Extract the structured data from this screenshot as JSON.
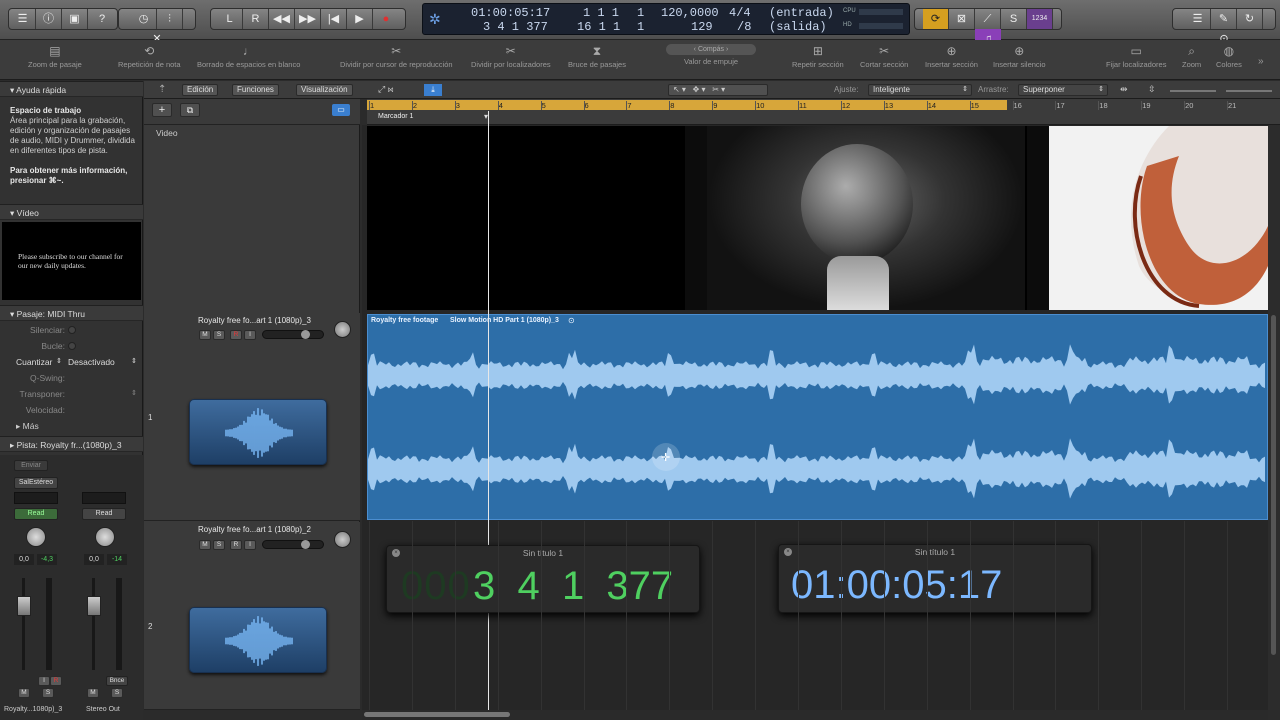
{
  "transport": {
    "position_time": "01:00:05:17",
    "position_bars": "3 4 1 377",
    "end_time_a": "1 1 1",
    "end_time_b": "1",
    "end_bars_a": "16 1 1",
    "end_bars_b": "1",
    "tempo": "120,0000",
    "tempo_sub": "129",
    "signature": "4/4",
    "signature_sub": "/8",
    "input_label": "(entrada)",
    "output_label": "(salida)",
    "cpu_label": "CPU",
    "hd_label": "HD",
    "count_in": "1234"
  },
  "toolbar": {
    "items": [
      {
        "label": "Zoom de pasaje",
        "icon": "piano-roll-icon"
      },
      {
        "label": "Repetición de nota",
        "icon": "repeat-icon"
      },
      {
        "label": "Borrado de espacios en blanco",
        "icon": "note-icon"
      },
      {
        "label": "Dividir por cursor de reproducción",
        "icon": "scissors-icon"
      },
      {
        "label": "Dividir por localizadores",
        "icon": "scissors-icon"
      },
      {
        "label": "Bruce de pasajes",
        "icon": "crossfade-icon"
      },
      {
        "label": "Valor de empuje",
        "icon": "nudge-icon"
      },
      {
        "label": "Repetir sección",
        "icon": "repeat-section-icon"
      },
      {
        "label": "Cortar sección",
        "icon": "cut-section-icon"
      },
      {
        "label": "Insertar sección",
        "icon": "insert-section-icon"
      },
      {
        "label": "Insertar silencio",
        "icon": "insert-silence-icon"
      },
      {
        "label": "Fijar localizadores",
        "icon": "locators-icon"
      },
      {
        "label": "Zoom",
        "icon": "zoom-icon"
      },
      {
        "label": "Colores",
        "icon": "palette-icon"
      }
    ],
    "compas_label": "Compás"
  },
  "quickhelp": {
    "header": "Ayuda rápida",
    "title": "Espacio de trabajo",
    "body": "Área principal para la grabación, edición y organización de pasajes de audio, MIDI y Drummer, dividida en diferentes tipos de pista.",
    "more": "Para obtener más información, presionar ⌘~."
  },
  "video_section": {
    "header": "Vídeo",
    "overlay_text": "Please subscribe to our channel for our new daily updates."
  },
  "inspector": {
    "region_header": "Pasaje:",
    "region_value": "MIDI Thru",
    "rows": [
      {
        "label": "Silenciar:",
        "value": ""
      },
      {
        "label": "Bucle:",
        "value": ""
      },
      {
        "label": "Cuantizar",
        "value": "Desactivado"
      },
      {
        "label": "Q-Swing:",
        "value": ""
      },
      {
        "label": "Transponer:",
        "value": ""
      },
      {
        "label": "Velocidad:",
        "value": ""
      }
    ],
    "more": "Más",
    "track_header": "Pista:",
    "track_value": "Royalty fr...(1080p)_3"
  },
  "channelstrips": {
    "send_label": "Enviar",
    "output_label": "SalEstéreo",
    "read_a": "Read",
    "read_b": "Read",
    "vol_a": "0,0",
    "peak_a": "-4,3",
    "vol_b": "0,0",
    "peak_b": "-14",
    "bnce": "Bnce",
    "name_a": "Royalty...1080p)_3",
    "name_b": "Stereo Out"
  },
  "tracksarea": {
    "menus": [
      "Edición",
      "Funciones",
      "Visualización"
    ],
    "ajuste_label": "Ajuste:",
    "ajuste_value": "Inteligente",
    "arrastre_label": "Arrastre:",
    "arrastre_value": "Superponer",
    "marker": "Marcador 1",
    "video_track_label": "Video",
    "ruler_numbers": [
      "1",
      "2",
      "3",
      "4",
      "5",
      "6",
      "7",
      "8",
      "9",
      "10",
      "11",
      "12",
      "13",
      "14",
      "15",
      "16",
      "17",
      "18",
      "19",
      "20",
      "21"
    ]
  },
  "tracks": [
    {
      "number": "1",
      "name": "Royalty free fo...art 1 (1080p)_3",
      "mute": "M",
      "solo": "S",
      "rec": "R",
      "input": "I"
    },
    {
      "number": "2",
      "name": "Royalty free fo...art 1 (1080p)_2",
      "mute": "M",
      "solo": "S",
      "rec": "R",
      "input": "I"
    }
  ],
  "region": {
    "title": "Royalty free footage",
    "subtitle": "Slow Motion HD Part 1 (1080p)_3"
  },
  "floating": {
    "left": {
      "title": "Sin título 1",
      "dim": "000",
      "value": "3  4  1  377"
    },
    "right": {
      "title": "Sin título 1",
      "value": "01:00:05:17"
    }
  },
  "colors": {
    "region": "#2d6ea8",
    "cycle": "#d7a63a",
    "lcd_green": "#4fd060",
    "lcd_blue": "#7cb8ff"
  }
}
